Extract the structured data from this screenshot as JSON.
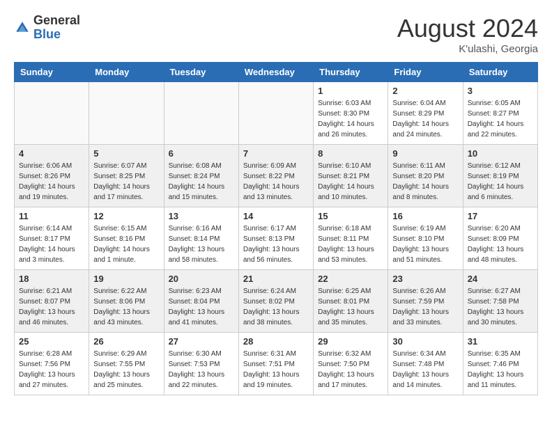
{
  "header": {
    "logo_general": "General",
    "logo_blue": "Blue",
    "month_year": "August 2024",
    "location": "K'ulashi, Georgia"
  },
  "days_of_week": [
    "Sunday",
    "Monday",
    "Tuesday",
    "Wednesday",
    "Thursday",
    "Friday",
    "Saturday"
  ],
  "weeks": [
    {
      "row_bg": "white",
      "days": [
        {
          "num": "",
          "info": "",
          "empty": true
        },
        {
          "num": "",
          "info": "",
          "empty": true
        },
        {
          "num": "",
          "info": "",
          "empty": true
        },
        {
          "num": "",
          "info": "",
          "empty": true
        },
        {
          "num": "1",
          "info": "Sunrise: 6:03 AM\nSunset: 8:30 PM\nDaylight: 14 hours\nand 26 minutes."
        },
        {
          "num": "2",
          "info": "Sunrise: 6:04 AM\nSunset: 8:29 PM\nDaylight: 14 hours\nand 24 minutes."
        },
        {
          "num": "3",
          "info": "Sunrise: 6:05 AM\nSunset: 8:27 PM\nDaylight: 14 hours\nand 22 minutes."
        }
      ]
    },
    {
      "row_bg": "gray",
      "days": [
        {
          "num": "4",
          "info": "Sunrise: 6:06 AM\nSunset: 8:26 PM\nDaylight: 14 hours\nand 19 minutes."
        },
        {
          "num": "5",
          "info": "Sunrise: 6:07 AM\nSunset: 8:25 PM\nDaylight: 14 hours\nand 17 minutes."
        },
        {
          "num": "6",
          "info": "Sunrise: 6:08 AM\nSunset: 8:24 PM\nDaylight: 14 hours\nand 15 minutes."
        },
        {
          "num": "7",
          "info": "Sunrise: 6:09 AM\nSunset: 8:22 PM\nDaylight: 14 hours\nand 13 minutes."
        },
        {
          "num": "8",
          "info": "Sunrise: 6:10 AM\nSunset: 8:21 PM\nDaylight: 14 hours\nand 10 minutes."
        },
        {
          "num": "9",
          "info": "Sunrise: 6:11 AM\nSunset: 8:20 PM\nDaylight: 14 hours\nand 8 minutes."
        },
        {
          "num": "10",
          "info": "Sunrise: 6:12 AM\nSunset: 8:19 PM\nDaylight: 14 hours\nand 6 minutes."
        }
      ]
    },
    {
      "row_bg": "white",
      "days": [
        {
          "num": "11",
          "info": "Sunrise: 6:14 AM\nSunset: 8:17 PM\nDaylight: 14 hours\nand 3 minutes."
        },
        {
          "num": "12",
          "info": "Sunrise: 6:15 AM\nSunset: 8:16 PM\nDaylight: 14 hours\nand 1 minute."
        },
        {
          "num": "13",
          "info": "Sunrise: 6:16 AM\nSunset: 8:14 PM\nDaylight: 13 hours\nand 58 minutes."
        },
        {
          "num": "14",
          "info": "Sunrise: 6:17 AM\nSunset: 8:13 PM\nDaylight: 13 hours\nand 56 minutes."
        },
        {
          "num": "15",
          "info": "Sunrise: 6:18 AM\nSunset: 8:11 PM\nDaylight: 13 hours\nand 53 minutes."
        },
        {
          "num": "16",
          "info": "Sunrise: 6:19 AM\nSunset: 8:10 PM\nDaylight: 13 hours\nand 51 minutes."
        },
        {
          "num": "17",
          "info": "Sunrise: 6:20 AM\nSunset: 8:09 PM\nDaylight: 13 hours\nand 48 minutes."
        }
      ]
    },
    {
      "row_bg": "gray",
      "days": [
        {
          "num": "18",
          "info": "Sunrise: 6:21 AM\nSunset: 8:07 PM\nDaylight: 13 hours\nand 46 minutes."
        },
        {
          "num": "19",
          "info": "Sunrise: 6:22 AM\nSunset: 8:06 PM\nDaylight: 13 hours\nand 43 minutes."
        },
        {
          "num": "20",
          "info": "Sunrise: 6:23 AM\nSunset: 8:04 PM\nDaylight: 13 hours\nand 41 minutes."
        },
        {
          "num": "21",
          "info": "Sunrise: 6:24 AM\nSunset: 8:02 PM\nDaylight: 13 hours\nand 38 minutes."
        },
        {
          "num": "22",
          "info": "Sunrise: 6:25 AM\nSunset: 8:01 PM\nDaylight: 13 hours\nand 35 minutes."
        },
        {
          "num": "23",
          "info": "Sunrise: 6:26 AM\nSunset: 7:59 PM\nDaylight: 13 hours\nand 33 minutes."
        },
        {
          "num": "24",
          "info": "Sunrise: 6:27 AM\nSunset: 7:58 PM\nDaylight: 13 hours\nand 30 minutes."
        }
      ]
    },
    {
      "row_bg": "white",
      "days": [
        {
          "num": "25",
          "info": "Sunrise: 6:28 AM\nSunset: 7:56 PM\nDaylight: 13 hours\nand 27 minutes."
        },
        {
          "num": "26",
          "info": "Sunrise: 6:29 AM\nSunset: 7:55 PM\nDaylight: 13 hours\nand 25 minutes."
        },
        {
          "num": "27",
          "info": "Sunrise: 6:30 AM\nSunset: 7:53 PM\nDaylight: 13 hours\nand 22 minutes."
        },
        {
          "num": "28",
          "info": "Sunrise: 6:31 AM\nSunset: 7:51 PM\nDaylight: 13 hours\nand 19 minutes."
        },
        {
          "num": "29",
          "info": "Sunrise: 6:32 AM\nSunset: 7:50 PM\nDaylight: 13 hours\nand 17 minutes."
        },
        {
          "num": "30",
          "info": "Sunrise: 6:34 AM\nSunset: 7:48 PM\nDaylight: 13 hours\nand 14 minutes."
        },
        {
          "num": "31",
          "info": "Sunrise: 6:35 AM\nSunset: 7:46 PM\nDaylight: 13 hours\nand 11 minutes."
        }
      ]
    }
  ]
}
